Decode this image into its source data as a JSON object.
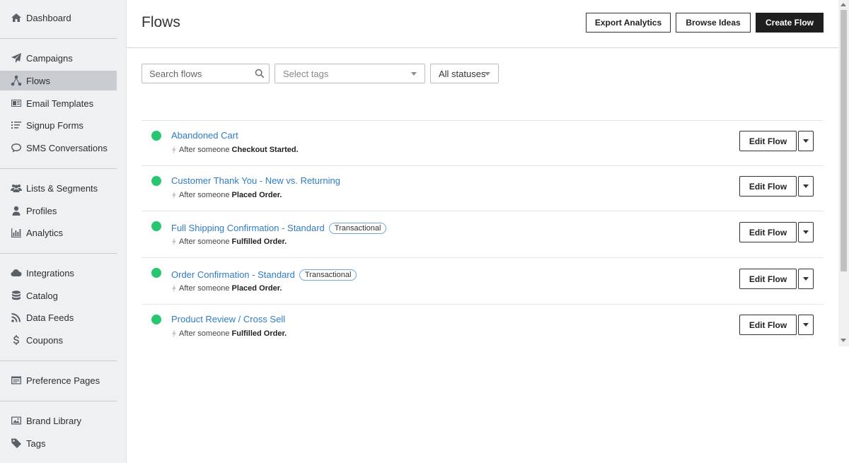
{
  "sidebar": {
    "items": [
      {
        "label": "Dashboard",
        "icon": "home-icon"
      },
      {
        "label": "Campaigns",
        "icon": "paper-plane-icon"
      },
      {
        "label": "Flows",
        "icon": "flows-icon",
        "active": true
      },
      {
        "label": "Email Templates",
        "icon": "template-icon"
      },
      {
        "label": "Signup Forms",
        "icon": "form-icon"
      },
      {
        "label": "SMS Conversations",
        "icon": "chat-icon"
      },
      {
        "label": "Lists & Segments",
        "icon": "users-icon"
      },
      {
        "label": "Profiles",
        "icon": "user-icon"
      },
      {
        "label": "Analytics",
        "icon": "bar-chart-icon"
      },
      {
        "label": "Integrations",
        "icon": "cloud-icon"
      },
      {
        "label": "Catalog",
        "icon": "database-icon"
      },
      {
        "label": "Data Feeds",
        "icon": "rss-icon"
      },
      {
        "label": "Coupons",
        "icon": "dollar-icon"
      },
      {
        "label": "Preference Pages",
        "icon": "window-icon"
      },
      {
        "label": "Brand Library",
        "icon": "image-icon"
      },
      {
        "label": "Tags",
        "icon": "tag-icon"
      }
    ]
  },
  "header": {
    "title": "Flows",
    "export_label": "Export Analytics",
    "browse_label": "Browse Ideas",
    "create_label": "Create Flow"
  },
  "filters": {
    "search_placeholder": "Search flows",
    "tags_placeholder": "Select tags",
    "status_value": "All statuses"
  },
  "flows": [
    {
      "name": "Abandoned Cart",
      "badge": "",
      "trigger_prefix": "After someone",
      "trigger_event": "Checkout Started.",
      "status": "live"
    },
    {
      "name": "Customer Thank You - New vs. Returning",
      "badge": "",
      "trigger_prefix": "After someone",
      "trigger_event": "Placed Order.",
      "status": "live"
    },
    {
      "name": "Full Shipping Confirmation - Standard",
      "badge": "Transactional",
      "trigger_prefix": "After someone",
      "trigger_event": "Fulfilled Order.",
      "status": "live"
    },
    {
      "name": "Order Confirmation - Standard",
      "badge": "Transactional",
      "trigger_prefix": "After someone",
      "trigger_event": "Placed Order.",
      "status": "live"
    },
    {
      "name": "Product Review / Cross Sell",
      "badge": "",
      "trigger_prefix": "After someone",
      "trigger_event": "Fulfilled Order.",
      "status": "live"
    }
  ],
  "edit_label": "Edit Flow",
  "colors": {
    "live": "#28c76f",
    "link": "#2e7cc3",
    "sidebar_bg": "#eef0f2",
    "active_bg": "#c9cdd2"
  }
}
